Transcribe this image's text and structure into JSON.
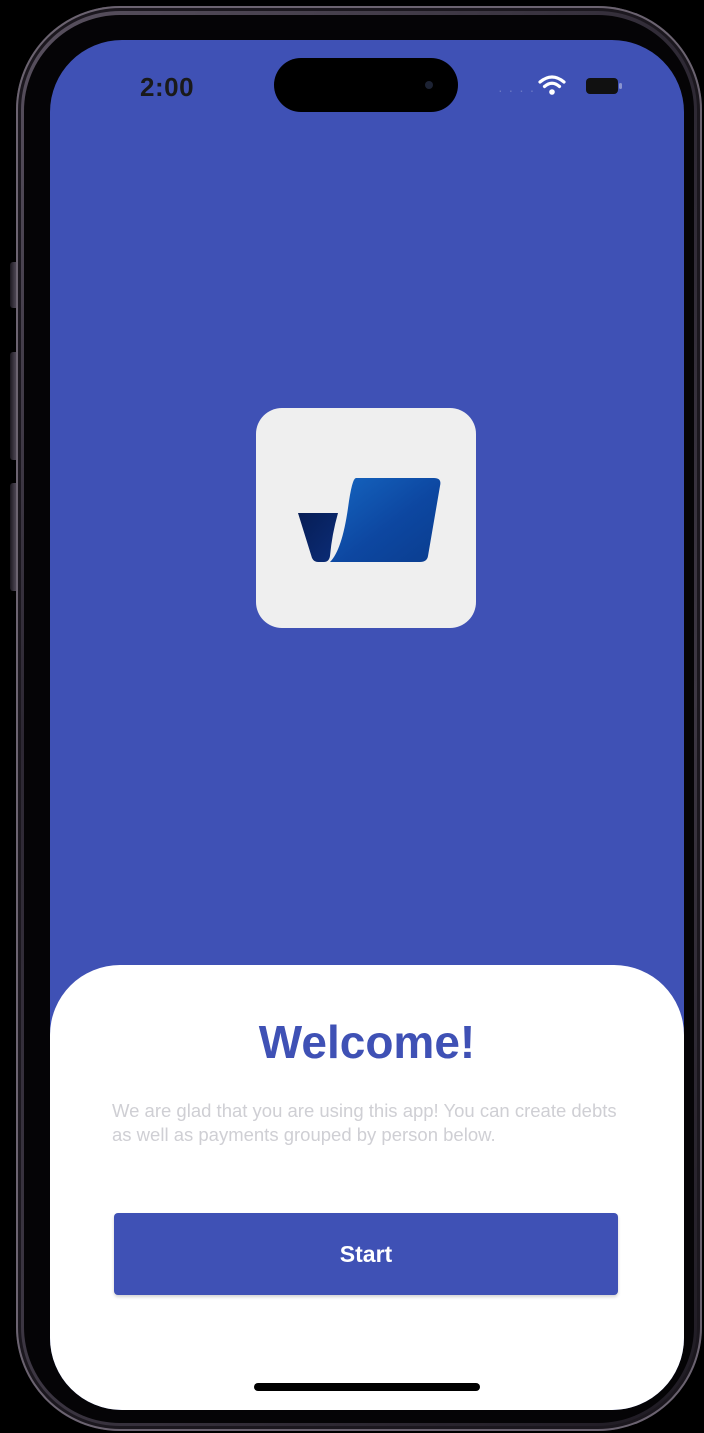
{
  "status_bar": {
    "time": "2:00",
    "signal_icon": "cellular-dots-icon",
    "wifi_icon": "wifi-icon",
    "battery_icon": "battery-icon"
  },
  "app": {
    "logo_icon": "app-logo-icon",
    "brand_color": "#3f51b5",
    "background_color": "#3f51b5"
  },
  "welcome_sheet": {
    "title": "Welcome!",
    "body": "We are glad that you are using this app! You can create debts as well as payments grouped by person below.",
    "start_label": "Start"
  }
}
